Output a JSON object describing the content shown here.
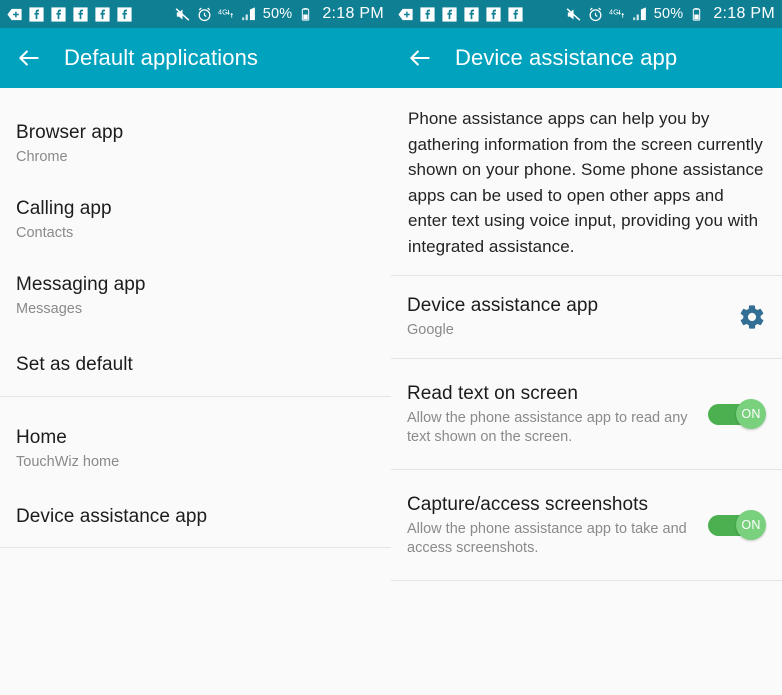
{
  "status_bar": {
    "notification_icons": [
      "add-call-icon",
      "facebook-icon",
      "facebook-icon",
      "facebook-icon",
      "facebook-icon",
      "facebook-icon"
    ],
    "mute_icon": "mute-icon",
    "alarm_icon": "alarm-icon",
    "network_label": "4G",
    "network_icon": "4g-data-icon",
    "signal_icon": "signal-bars-icon",
    "battery_percent": "50%",
    "battery_icon": "battery-icon",
    "time": "2:18 PM"
  },
  "left_screen": {
    "appbar": {
      "back_icon": "back-arrow-icon",
      "title": "Default applications"
    },
    "items": [
      {
        "title": "Browser app",
        "subtitle": "Chrome"
      },
      {
        "title": "Calling app",
        "subtitle": "Contacts"
      },
      {
        "title": "Messaging app",
        "subtitle": "Messages"
      },
      {
        "title": "Set as default",
        "subtitle": ""
      },
      {
        "title": "Home",
        "subtitle": "TouchWiz home"
      },
      {
        "title": "Device assistance app",
        "subtitle": ""
      }
    ]
  },
  "right_screen": {
    "appbar": {
      "back_icon": "back-arrow-icon",
      "title": "Device assistance app"
    },
    "description": "Phone assistance apps can help you by gathering information from the screen currently shown on your phone. Some phone assistance apps can be used to open other apps and enter text using voice input, providing you with integrated assistance.",
    "assist_row": {
      "title": "Device assistance app",
      "subtitle": "Google",
      "settings_icon": "gear-icon"
    },
    "toggles": [
      {
        "title": "Read text on screen",
        "subtitle": "Allow the phone assistance app to read any text shown on the screen.",
        "state_label": "ON",
        "on": true
      },
      {
        "title": "Capture/access screenshots",
        "subtitle": "Allow the phone assistance app to take and access screenshots.",
        "state_label": "ON",
        "on": true
      }
    ]
  },
  "colors": {
    "appbar": "#00a2bd",
    "statusbar": "#0f7f94",
    "toggle_track": "#4caf50",
    "toggle_knob": "#79d17d",
    "gear": "#336e94",
    "background": "#fafafa"
  }
}
